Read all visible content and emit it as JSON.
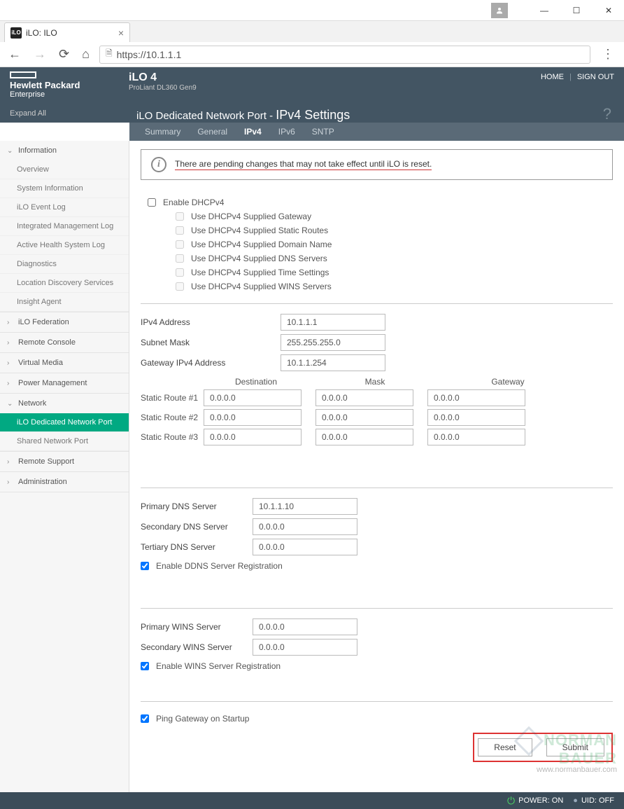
{
  "browser": {
    "tab_title": "iLO: ILO",
    "url": "https://10.1.1.1"
  },
  "brand": {
    "line1": "Hewlett Packard",
    "line2": "Enterprise"
  },
  "product": {
    "name": "iLO 4",
    "model": "ProLiant DL360 Gen9"
  },
  "toplinks": {
    "home": "HOME",
    "signout": "SIGN OUT"
  },
  "expand_all": "Expand All",
  "page_title_prefix": "iLO Dedicated Network Port - ",
  "page_title_main": "IPv4 Settings",
  "tabs": [
    "Summary",
    "General",
    "IPv4",
    "IPv6",
    "SNTP"
  ],
  "active_tab": "IPv4",
  "alert_msg": "There are pending changes that may not take effect until iLO is reset.",
  "sidebar": [
    {
      "label": "Information",
      "expanded": true,
      "items": [
        "Overview",
        "System Information",
        "iLO Event Log",
        "Integrated Management Log",
        "Active Health System Log",
        "Diagnostics",
        "Location Discovery Services",
        "Insight Agent"
      ]
    },
    {
      "label": "iLO Federation",
      "expanded": false
    },
    {
      "label": "Remote Console",
      "expanded": false
    },
    {
      "label": "Virtual Media",
      "expanded": false
    },
    {
      "label": "Power Management",
      "expanded": false
    },
    {
      "label": "Network",
      "expanded": true,
      "items": [
        "iLO Dedicated Network Port",
        "Shared Network Port"
      ],
      "active": "iLO Dedicated Network Port"
    },
    {
      "label": "Remote Support",
      "expanded": false
    },
    {
      "label": "Administration",
      "expanded": false
    }
  ],
  "dhcp": {
    "enable": "Enable DHCPv4",
    "opts": [
      "Use DHCPv4 Supplied Gateway",
      "Use DHCPv4 Supplied Static Routes",
      "Use DHCPv4 Supplied Domain Name",
      "Use DHCPv4 Supplied DNS Servers",
      "Use DHCPv4 Supplied Time Settings",
      "Use DHCPv4 Supplied WINS Servers"
    ]
  },
  "ip": {
    "addr_label": "IPv4 Address",
    "addr": "10.1.1.1",
    "mask_label": "Subnet Mask",
    "mask": "255.255.255.0",
    "gw_label": "Gateway IPv4 Address",
    "gw": "10.1.1.254"
  },
  "route_headers": {
    "dest": "Destination",
    "mask": "Mask",
    "gw": "Gateway"
  },
  "routes": [
    {
      "label": "Static Route #1",
      "dest": "0.0.0.0",
      "mask": "0.0.0.0",
      "gw": "0.0.0.0"
    },
    {
      "label": "Static Route #2",
      "dest": "0.0.0.0",
      "mask": "0.0.0.0",
      "gw": "0.0.0.0"
    },
    {
      "label": "Static Route #3",
      "dest": "0.0.0.0",
      "mask": "0.0.0.0",
      "gw": "0.0.0.0"
    }
  ],
  "dns": {
    "primary_label": "Primary DNS Server",
    "primary": "10.1.1.10",
    "secondary_label": "Secondary DNS Server",
    "secondary": "0.0.0.0",
    "tertiary_label": "Tertiary DNS Server",
    "tertiary": "0.0.0.0",
    "ddns_label": "Enable DDNS Server Registration",
    "ddns_checked": true
  },
  "wins": {
    "primary_label": "Primary WINS Server",
    "primary": "0.0.0.0",
    "secondary_label": "Secondary WINS Server",
    "secondary": "0.0.0.0",
    "reg_label": "Enable WINS Server Registration",
    "reg_checked": true
  },
  "ping": {
    "label": "Ping Gateway on Startup",
    "checked": true
  },
  "buttons": {
    "reset": "Reset",
    "submit": "Submit"
  },
  "status": {
    "power": "POWER: ON",
    "uid": "UID: OFF"
  },
  "watermark": {
    "l1": "NORMAN",
    "l2": "BAUER",
    "url": "www.normanbauer.com"
  }
}
